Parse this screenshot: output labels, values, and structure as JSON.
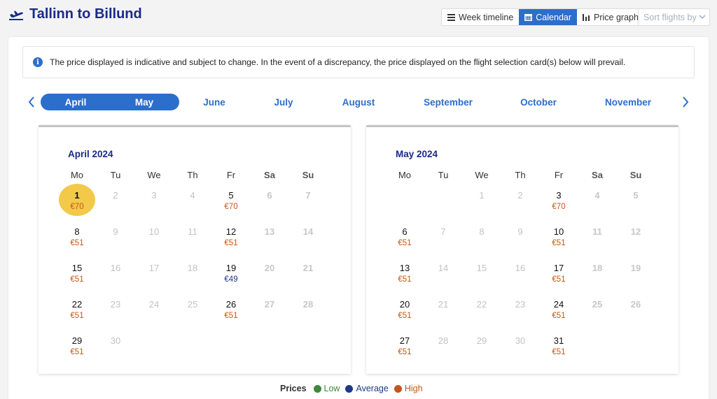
{
  "header": {
    "title": "Tallinn to Billund",
    "icon": "plane-takeoff-icon"
  },
  "views": [
    {
      "label": "Week timeline",
      "icon": "list-icon",
      "active": false
    },
    {
      "label": "Calendar",
      "icon": "calendar-icon",
      "active": true
    },
    {
      "label": "Price graph",
      "icon": "bar-chart-icon",
      "active": false
    }
  ],
  "sort": {
    "placeholder": "Sort flights by"
  },
  "notice": {
    "text": "The price displayed is indicative and subject to change. In the event of a discrepancy, the price displayed on the flight selection card(s) below will prevail."
  },
  "months": [
    "April",
    "May",
    "June",
    "July",
    "August",
    "September",
    "October",
    "November"
  ],
  "active_months": [
    "April",
    "May"
  ],
  "weekdays": [
    "Mo",
    "Tu",
    "We",
    "Th",
    "Fr",
    "Sa",
    "Su"
  ],
  "colors": {
    "low": "#3b8a3b",
    "average": "#1b3a8a",
    "high": "#c4561a",
    "accent": "#2c6ecb",
    "selected": "#f3c94a"
  },
  "calendars": [
    {
      "title": "April 2024",
      "offset": 0,
      "days": 30,
      "selected": 1,
      "prices": {
        "1": {
          "p": "€70",
          "level": "high"
        },
        "5": {
          "p": "€70",
          "level": "high"
        },
        "8": {
          "p": "€51",
          "level": "high"
        },
        "12": {
          "p": "€51",
          "level": "high"
        },
        "15": {
          "p": "€51",
          "level": "high"
        },
        "19": {
          "p": "€49",
          "level": "average"
        },
        "22": {
          "p": "€51",
          "level": "high"
        },
        "26": {
          "p": "€51",
          "level": "high"
        },
        "29": {
          "p": "€51",
          "level": "high"
        }
      }
    },
    {
      "title": "May 2024",
      "offset": 2,
      "days": 31,
      "selected": null,
      "prices": {
        "3": {
          "p": "€70",
          "level": "high"
        },
        "6": {
          "p": "€51",
          "level": "high"
        },
        "10": {
          "p": "€51",
          "level": "high"
        },
        "13": {
          "p": "€51",
          "level": "high"
        },
        "17": {
          "p": "€51",
          "level": "high"
        },
        "20": {
          "p": "€51",
          "level": "high"
        },
        "24": {
          "p": "€51",
          "level": "high"
        },
        "27": {
          "p": "€51",
          "level": "high"
        },
        "31": {
          "p": "€51",
          "level": "high"
        }
      }
    }
  ],
  "legend": {
    "label": "Prices",
    "items": [
      {
        "label": "Low",
        "level": "low"
      },
      {
        "label": "Average",
        "level": "average"
      },
      {
        "label": "High",
        "level": "high"
      }
    ]
  }
}
